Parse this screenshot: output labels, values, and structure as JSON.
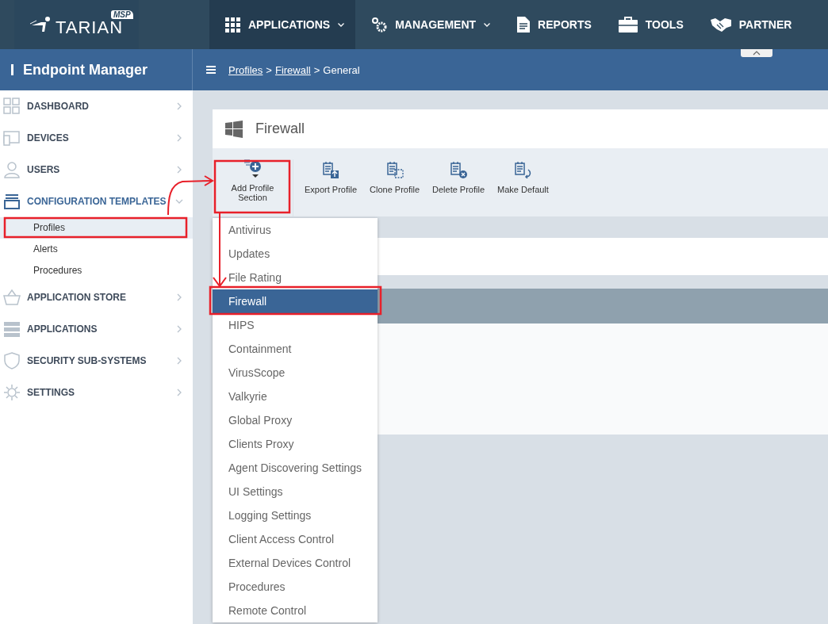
{
  "top_nav": {
    "logo": {
      "brand": "TARIAN",
      "badge": "MSP"
    },
    "items": [
      {
        "label": "APPLICATIONS",
        "caret": true,
        "selected": true
      },
      {
        "label": "MANAGEMENT",
        "caret": true,
        "selected": false
      },
      {
        "label": "REPORTS",
        "caret": false,
        "selected": false
      },
      {
        "label": "TOOLS",
        "caret": false,
        "selected": false
      },
      {
        "label": "PARTNER",
        "caret": false,
        "selected": false
      }
    ]
  },
  "sub_header": {
    "title": "Endpoint Manager",
    "breadcrumb": [
      {
        "kind": "link",
        "label": "Profiles"
      },
      {
        "kind": "separator",
        "label": ">"
      },
      {
        "kind": "link",
        "label": "Firewall"
      },
      {
        "kind": "separator",
        "label": ">"
      },
      {
        "kind": "text",
        "label": "General"
      }
    ]
  },
  "sidebar": {
    "items": [
      {
        "label": "DASHBOARD",
        "expanded": false
      },
      {
        "label": "DEVICES",
        "expanded": false
      },
      {
        "label": "USERS",
        "expanded": false
      },
      {
        "label": "CONFIGURATION TEMPLATES",
        "expanded": true,
        "children": [
          {
            "label": "Profiles",
            "selected": true
          },
          {
            "label": "Alerts",
            "selected": false
          },
          {
            "label": "Procedures",
            "selected": false
          }
        ]
      },
      {
        "label": "APPLICATION STORE",
        "expanded": false
      },
      {
        "label": "APPLICATIONS",
        "expanded": false
      },
      {
        "label": "SECURITY SUB-SYSTEMS",
        "expanded": false
      },
      {
        "label": "SETTINGS",
        "expanded": false
      }
    ]
  },
  "profile": {
    "title": "Firewall",
    "toolbar": [
      {
        "label": "Add Profile Section"
      },
      {
        "label": "Export Profile"
      },
      {
        "label": "Clone Profile"
      },
      {
        "label": "Delete Profile"
      },
      {
        "label": "Make Default"
      }
    ],
    "section_menu": [
      {
        "label": "Antivirus",
        "selected": false
      },
      {
        "label": "Updates",
        "selected": false
      },
      {
        "label": "File Rating",
        "selected": false
      },
      {
        "label": "Firewall",
        "selected": true
      },
      {
        "label": "HIPS",
        "selected": false
      },
      {
        "label": "Containment",
        "selected": false
      },
      {
        "label": "VirusScope",
        "selected": false
      },
      {
        "label": "Valkyrie",
        "selected": false
      },
      {
        "label": "Global Proxy",
        "selected": false
      },
      {
        "label": "Clients Proxy",
        "selected": false
      },
      {
        "label": "Agent Discovering Settings",
        "selected": false
      },
      {
        "label": "UI Settings",
        "selected": false
      },
      {
        "label": "Logging Settings",
        "selected": false
      },
      {
        "label": "Client Access Control",
        "selected": false
      },
      {
        "label": "External Devices Control",
        "selected": false
      },
      {
        "label": "Procedures",
        "selected": false
      },
      {
        "label": "Remote Control",
        "selected": false
      }
    ]
  }
}
